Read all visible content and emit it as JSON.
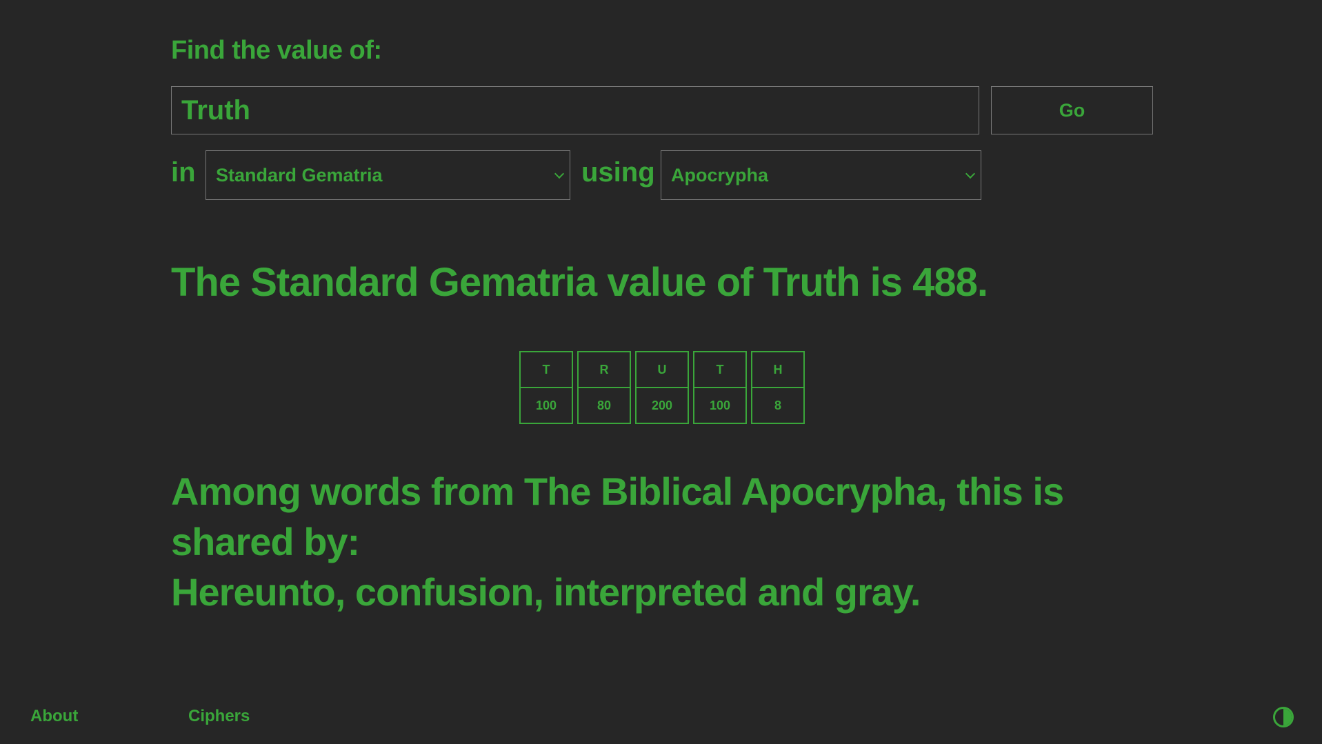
{
  "search": {
    "prompt": "Find the value of:",
    "query": "Truth",
    "go_label": "Go"
  },
  "options": {
    "in_label": "in",
    "using_label": "using",
    "cipher_selected": "Standard Gematria",
    "corpus_selected": "Apocrypha"
  },
  "result": {
    "summary": "The Standard Gematria value of Truth is 488.",
    "letters": [
      {
        "letter": "T",
        "value": "100"
      },
      {
        "letter": "R",
        "value": "80"
      },
      {
        "letter": "U",
        "value": "200"
      },
      {
        "letter": "T",
        "value": "100"
      },
      {
        "letter": "H",
        "value": "8"
      }
    ],
    "shared_intro": "Among words from The Biblical Apocrypha, this is shared by:",
    "shared_words": "Hereunto, confusion, interpreted and gray."
  },
  "footer": {
    "about": "About",
    "ciphers": "Ciphers"
  },
  "colors": {
    "background": "#262626",
    "accent": "#3aa63a",
    "border": "#7a7a7a"
  },
  "icons": {
    "theme_toggle": "contrast-icon",
    "select_arrow": "chevron-down-icon"
  }
}
